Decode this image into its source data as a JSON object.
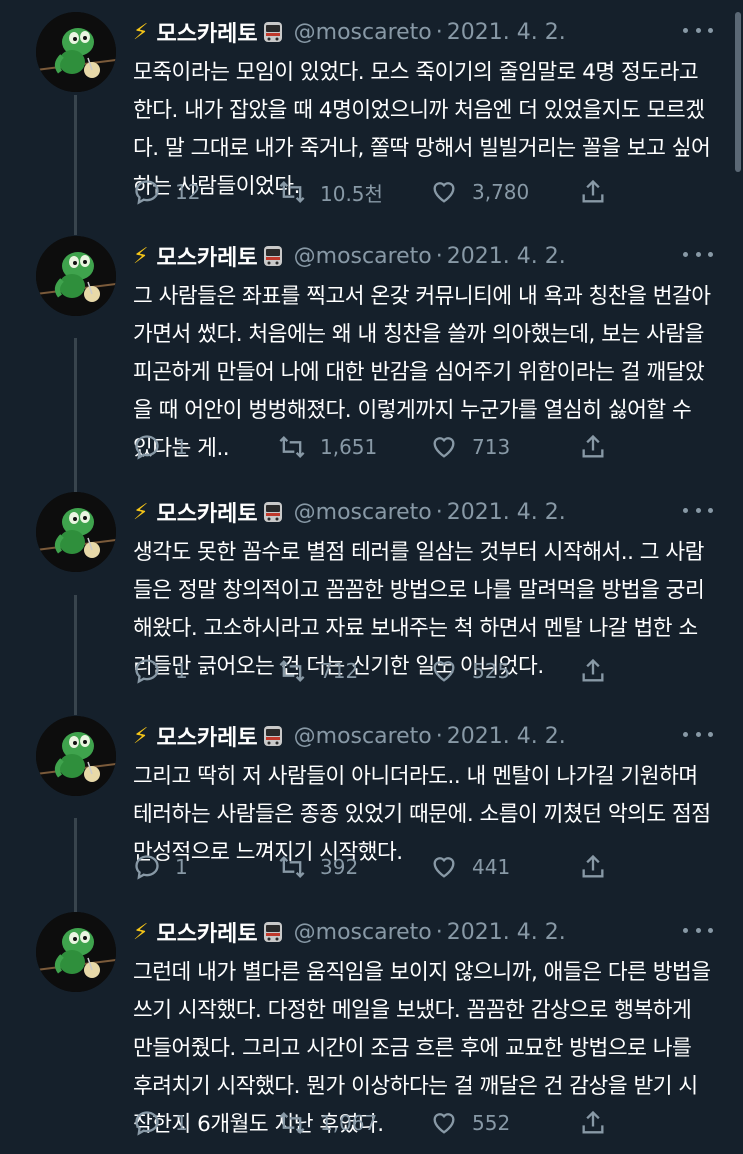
{
  "tweets": [
    {
      "display_name": "모스카레토",
      "handle": "@moscareto",
      "date": "2021. 4. 2.",
      "text": "모죽이라는 모임이 있었다. 모스 죽이기의 줄임말로 4명 정도라고 한다. 내가 잡았을 때 4명이었으니까 처음엔 더 있었을지도 모르겠다. 말 그대로 내가 죽거나, 쫄딱 망해서 빌빌거리는 꼴을 보고 싶어하는 사람들이었다.",
      "replies": "12",
      "retweets": "10.5천",
      "likes": "3,780"
    },
    {
      "display_name": "모스카레토",
      "handle": "@moscareto",
      "date": "2021. 4. 2.",
      "text": "그 사람들은 좌표를 찍고서 온갖 커뮤니티에 내 욕과 칭찬을 번갈아가면서 썼다. 처음에는 왜 내 칭찬을 쓸까 의아했는데, 보는 사람을 피곤하게 만들어 나에 대한 반감을 심어주기 위함이라는 걸 깨달았을 때 어안이 벙벙해졌다. 이렇게까지 누군가를 열심히 싫어할 수 있다는 게..",
      "replies": "1",
      "retweets": "1,651",
      "likes": "713"
    },
    {
      "display_name": "모스카레토",
      "handle": "@moscareto",
      "date": "2021. 4. 2.",
      "text": "생각도 못한 꼼수로 별점 테러를 일삼는 것부터 시작해서.. 그 사람들은 정말 창의적이고 꼼꼼한 방법으로 나를 말려먹을 방법을 궁리해왔다. 고소하시라고 자료 보내주는 척 하면서 멘탈 나갈 법한 소리들만 긁어오는 건 더는 신기한 일도 아니었다.",
      "replies": "1",
      "retweets": "712",
      "likes": "525"
    },
    {
      "display_name": "모스카레토",
      "handle": "@moscareto",
      "date": "2021. 4. 2.",
      "text": "그리고 딱히 저 사람들이 아니더라도.. 내 멘탈이 나가길 기원하며 테러하는 사람들은 종종 있었기 때문에. 소름이 끼쳤던 악의도 점점 만성적으로 느껴지기 시작했다.",
      "replies": "1",
      "retweets": "392",
      "likes": "441"
    },
    {
      "display_name": "모스카레토",
      "handle": "@moscareto",
      "date": "2021. 4. 2.",
      "text": "그런데 내가 별다른 움직임을 보이지 않으니까, 애들은 다른 방법을 쓰기 시작했다. 다정한 메일을 보냈다. 꼼꼼한 감상으로 행복하게 만들어줬다. 그리고 시간이 조금 흐른 후에 교묘한 방법으로 나를 후려치기 시작했다. 뭔가 이상하다는 걸 깨달은 건 감상을 받기 시작한지 6개월도 지난 후였다.",
      "replies": "1",
      "retweets": "1,067",
      "likes": "552"
    }
  ],
  "colors": {
    "background": "#15202b",
    "secondary_text": "#8899a6",
    "thread_line": "#38444d",
    "bolt": "#f5c518"
  },
  "icons": {
    "reply": "reply-icon",
    "retweet": "retweet-icon",
    "like": "heart-icon",
    "share": "share-icon",
    "more": "more-icon",
    "badge": "train-icon",
    "bolt": "lightning-icon"
  }
}
